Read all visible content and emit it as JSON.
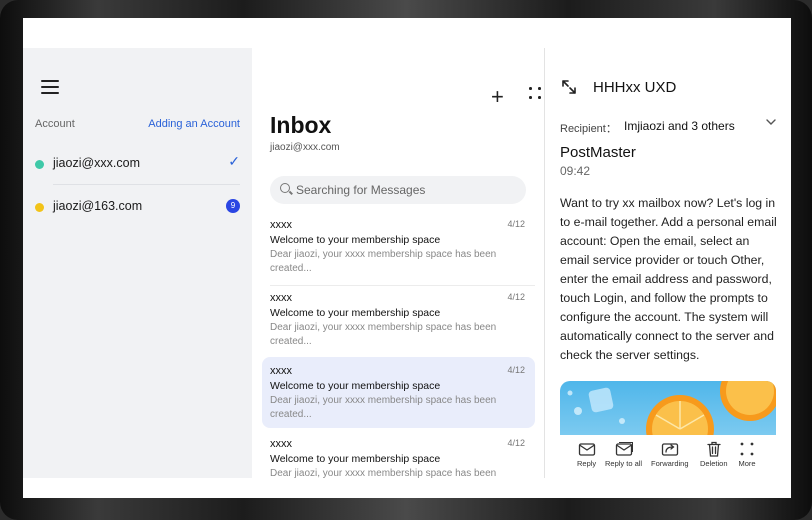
{
  "sidebar": {
    "account_label": "Account",
    "add_account_label": "Adding an Account",
    "accounts": [
      {
        "address": "jiaozi@xxx.com",
        "dot_color": "#3fc9a8",
        "selected": true
      },
      {
        "address": "jiaozi@163.com",
        "dot_color": "#f2c318",
        "unread_badge": "9"
      }
    ]
  },
  "list": {
    "title": "Inbox",
    "account": "jiaozi@xxx.com",
    "search_placeholder": "Searching for Messages",
    "messages": [
      {
        "from": "xxxx",
        "date": "4/12",
        "subject": "Welcome to your membership space",
        "preview": "Dear jiaozi, your xxxx membership space has been created..."
      },
      {
        "from": "xxxx",
        "date": "4/12",
        "subject": "Welcome to your membership space",
        "preview": "Dear jiaozi, your xxxx membership space has been created..."
      },
      {
        "from": "xxxx",
        "date": "4/12",
        "subject": "Welcome to your membership space",
        "preview": "Dear jiaozi, your xxxx membership space has been created..."
      },
      {
        "from": "xxxx",
        "date": "4/12",
        "subject": "Welcome to your membership space",
        "preview": "Dear jiaozi, your xxxx membership space has been"
      }
    ]
  },
  "detail": {
    "title": "HHHxx UXD",
    "recipient_label": "Recipient：",
    "recipient_value": "Imjiaozi and 3 others",
    "sender": "PostMaster",
    "time": "09:42",
    "body": "Want to try xx mailbox now? Let's log in to e-mail together. Add a personal email account: Open the email, select an email service provider or touch Other, enter the email address and password, touch Login, and follow the prompts to configure the account. The system will automatically connect to the server and check the server settings.",
    "toolbar": {
      "reply": "Reply",
      "reply_all": "Reply to all",
      "forward": "Forwarding",
      "delete": "Deletion",
      "more": "More"
    }
  },
  "colors": {
    "accent": "#2a62d8",
    "badge": "#2b46e3",
    "selected_row": "#e9edfb",
    "sidebar_bg": "#f1f2f4"
  }
}
